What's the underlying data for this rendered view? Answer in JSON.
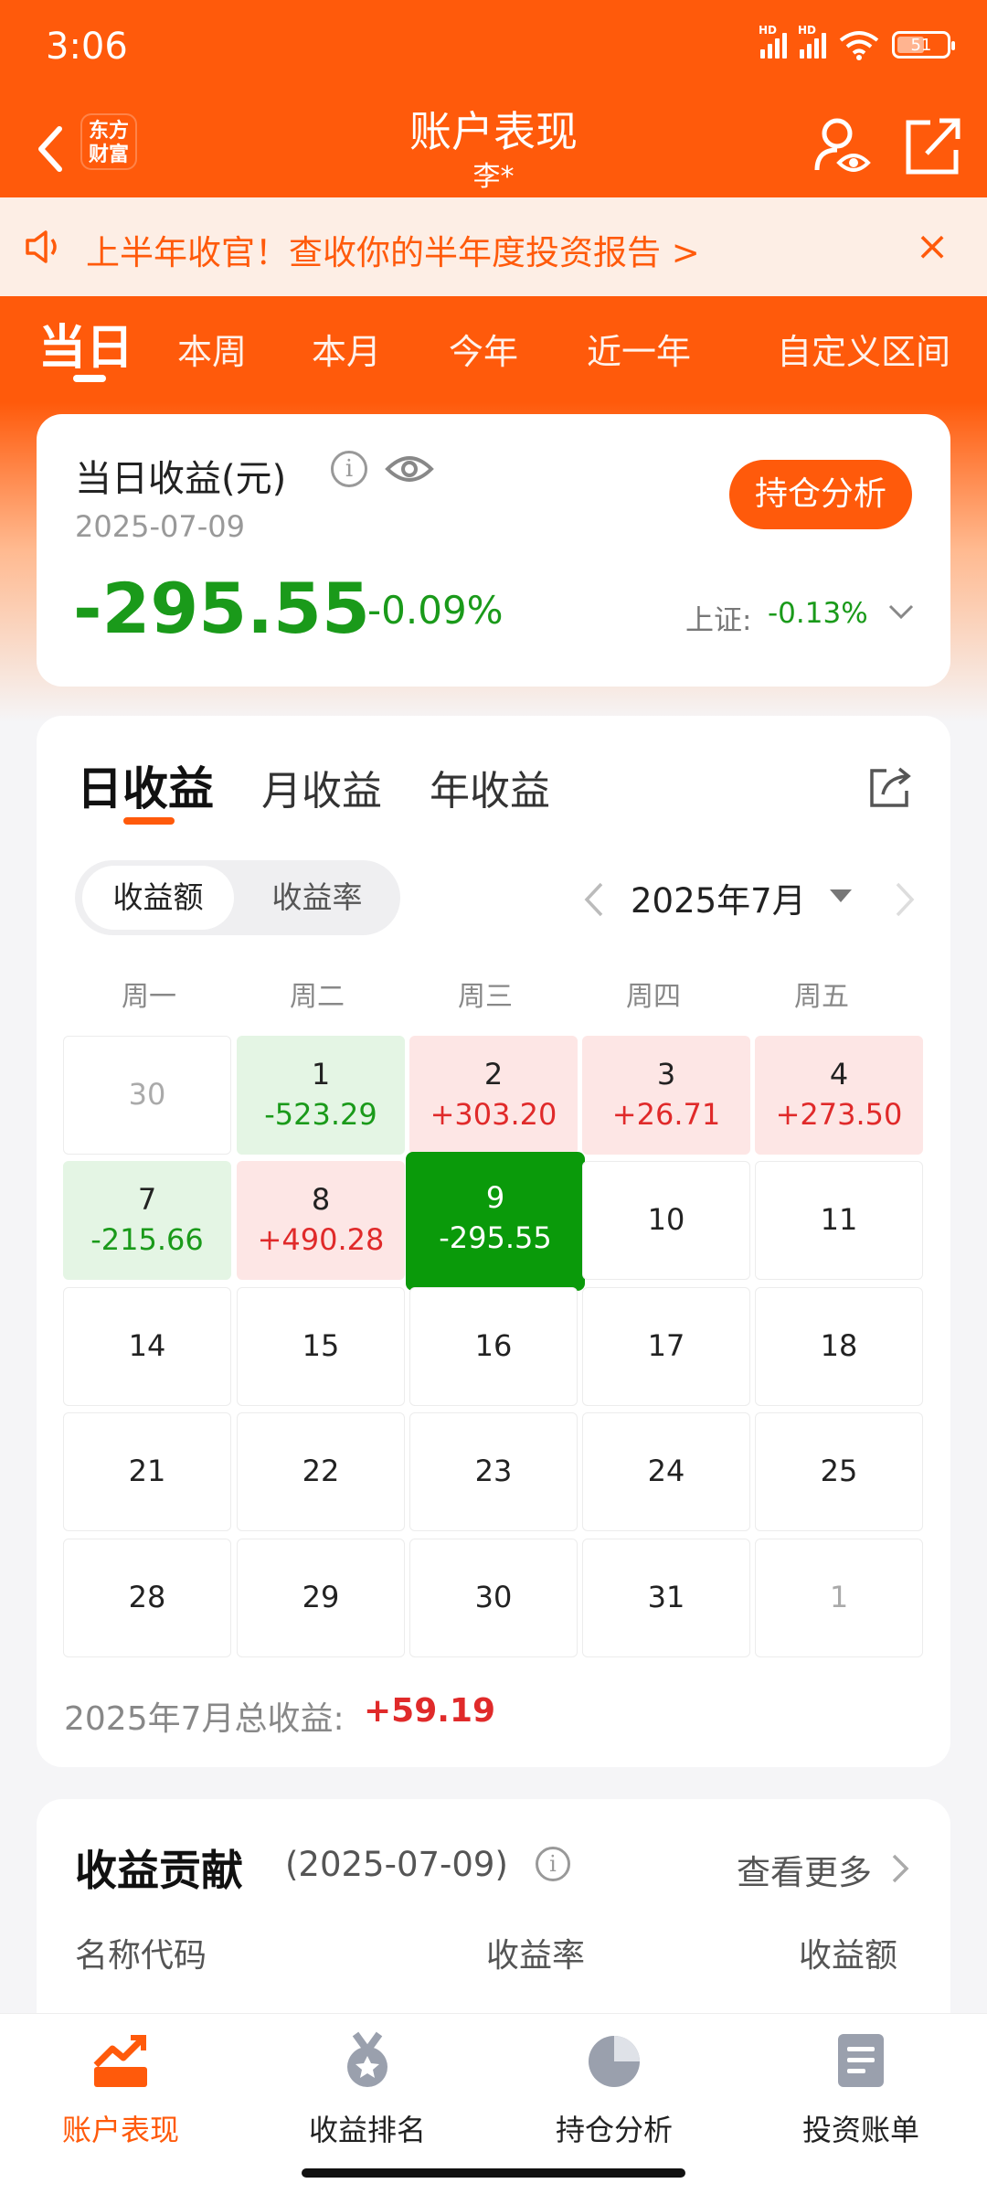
{
  "status_bar": {
    "time": "3:06",
    "battery": "51",
    "network_1": "HD",
    "network_2": "HD"
  },
  "nav": {
    "title": "账户表现",
    "subtitle": "李*",
    "logo_line1": "东方",
    "logo_line2": "财富"
  },
  "banner": {
    "text": "上半年收官！查收你的半年度投资报告 >",
    "close": "×"
  },
  "period_tabs": [
    "当日",
    "本周",
    "本月",
    "今年",
    "近一年",
    "自定义区间"
  ],
  "today_card": {
    "title": "当日收益(元)",
    "info": "i",
    "date": "2025-07-09",
    "button": "持仓分析",
    "value": "-295.55",
    "percent": "-0.09%",
    "index_label": "上证:",
    "index_value": "-0.13%"
  },
  "calendar": {
    "tabs": [
      "日收益",
      "月收益",
      "年收益"
    ],
    "toggle": [
      "收益额",
      "收益率"
    ],
    "month": "2025年7月",
    "weekdays": [
      "周一",
      "周二",
      "周三",
      "周四",
      "周五"
    ],
    "weeks": [
      [
        {
          "day": "30",
          "val": ""
        },
        {
          "day": "1",
          "val": "-523.29"
        },
        {
          "day": "2",
          "val": "+303.20"
        },
        {
          "day": "3",
          "val": "+26.71"
        },
        {
          "day": "4",
          "val": "+273.50"
        }
      ],
      [
        {
          "day": "7",
          "val": "-215.66"
        },
        {
          "day": "8",
          "val": "+490.28"
        },
        {
          "day": "9",
          "val": "-295.55"
        },
        {
          "day": "10",
          "val": ""
        },
        {
          "day": "11",
          "val": ""
        }
      ],
      [
        {
          "day": "14",
          "val": ""
        },
        {
          "day": "15",
          "val": ""
        },
        {
          "day": "16",
          "val": ""
        },
        {
          "day": "17",
          "val": ""
        },
        {
          "day": "18",
          "val": ""
        }
      ],
      [
        {
          "day": "21",
          "val": ""
        },
        {
          "day": "22",
          "val": ""
        },
        {
          "day": "23",
          "val": ""
        },
        {
          "day": "24",
          "val": ""
        },
        {
          "day": "25",
          "val": ""
        }
      ],
      [
        {
          "day": "28",
          "val": ""
        },
        {
          "day": "29",
          "val": ""
        },
        {
          "day": "30",
          "val": ""
        },
        {
          "day": "31",
          "val": ""
        },
        {
          "day": "1",
          "val": ""
        }
      ]
    ],
    "total_label": "2025年7月总收益:",
    "total_value": "+59.19"
  },
  "contribution": {
    "title": "收益贡献",
    "date": "(2025-07-09)",
    "info": "i",
    "more": "查看更多",
    "columns": [
      "名称代码",
      "收益率",
      "收益额"
    ]
  },
  "bottom_nav": [
    "账户表现",
    "收益排名",
    "持仓分析",
    "投资账单"
  ],
  "colors": {
    "brand": "#ff5a0b",
    "gain": "#e02a2a",
    "loss": "#1a9a1a"
  }
}
